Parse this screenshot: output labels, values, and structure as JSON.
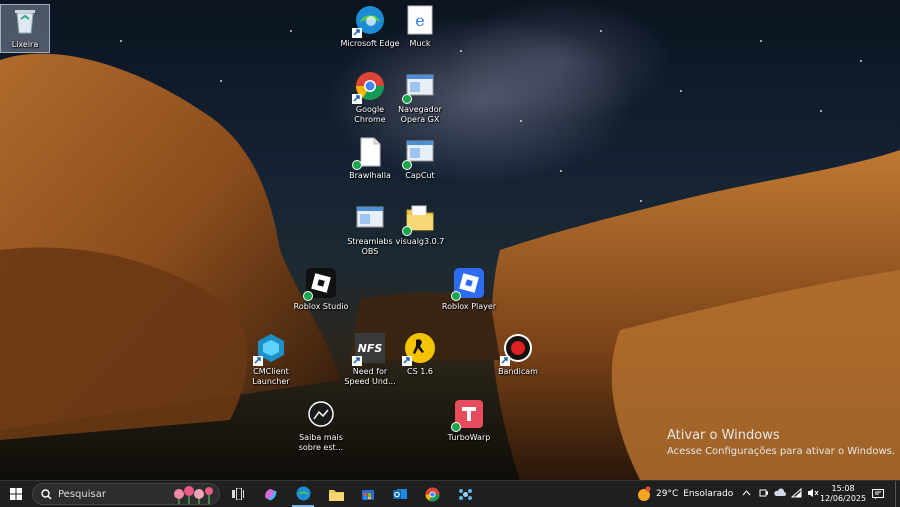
{
  "desktop_icons": [
    {
      "label": "Lixeira",
      "icon": "recycle-bin-icon",
      "selected": true
    },
    {
      "label": "Microsoft Edge",
      "icon": "edge-icon"
    },
    {
      "label": "Muck",
      "icon": "ie-icon"
    },
    {
      "label": "Google Chrome",
      "icon": "chrome-icon"
    },
    {
      "label": "Navegador Opera GX",
      "icon": "window-shortcut-icon"
    },
    {
      "label": "Brawlhalla",
      "icon": "blank-file-icon"
    },
    {
      "label": "CapCut",
      "icon": "window-shortcut-icon"
    },
    {
      "label": "Streamlabs OBS",
      "icon": "window-shortcut-icon"
    },
    {
      "label": "visualg3.0.7",
      "icon": "folder-icon"
    },
    {
      "label": "Roblox Studio",
      "icon": "roblox-studio-icon"
    },
    {
      "label": "Roblox Player",
      "icon": "roblox-player-icon"
    },
    {
      "label": "CMClient Launcher",
      "icon": "cmclient-icon"
    },
    {
      "label": "Need for Speed Und...",
      "icon": "nfs-icon"
    },
    {
      "label": "CS 1.6",
      "icon": "cs-icon"
    },
    {
      "label": "Bandicam",
      "icon": "bandicam-icon"
    },
    {
      "label": "Saiba mais sobre est...",
      "icon": "learn-more-icon"
    },
    {
      "label": "TurboWarp",
      "icon": "turbowarp-icon"
    }
  ],
  "activation": {
    "title": "Ativar o Windows",
    "subtitle": "Acesse Configurações para ativar o Windows."
  },
  "taskbar": {
    "search_placeholder": "Pesquisar",
    "pinned": [
      "task-view-icon",
      "copilot-icon",
      "edge-icon",
      "file-explorer-icon",
      "store-icon",
      "outlook-icon",
      "chrome-icon",
      "app-icon"
    ],
    "weather": {
      "temp": "29°C",
      "condition": "Ensolarado"
    },
    "clock": {
      "time": "15:08",
      "date": "12/06/2025"
    }
  },
  "colors": {
    "taskbar": "#1f1f1f",
    "check_badge": "#1aa64a",
    "roblox_blue": "#2c6bf2",
    "turbowarp_red": "#e74c5e"
  }
}
